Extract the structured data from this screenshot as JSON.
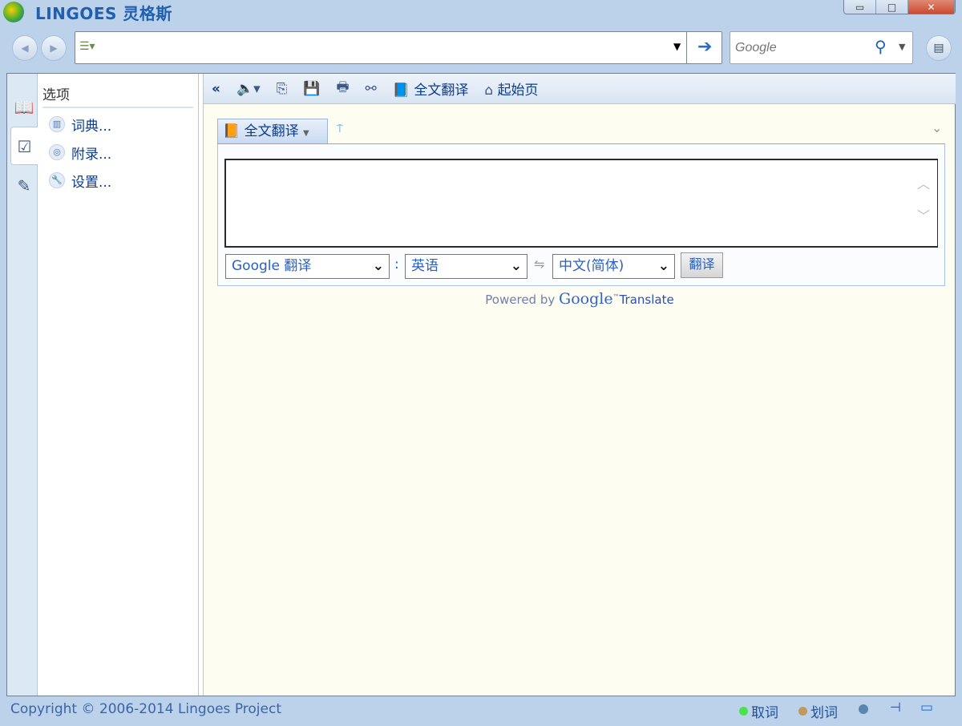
{
  "app": {
    "title": "LINGOES 灵格斯"
  },
  "window": {
    "minimize": "▭",
    "maximize": "□",
    "close": "✕"
  },
  "nav": {
    "address_value": "",
    "search_placeholder": "Google"
  },
  "sidebar": {
    "title": "选项",
    "items": [
      {
        "label": "词典...",
        "icon": "dictionary-icon"
      },
      {
        "label": "附录...",
        "icon": "appendix-icon"
      },
      {
        "label": "设置...",
        "icon": "wrench-icon"
      }
    ]
  },
  "toolbar": {
    "collapse": "«",
    "full_translate": "全文翻译",
    "home": "起始页"
  },
  "translate": {
    "tab_label": "全文翻译",
    "input_value": "",
    "engine": "Google 翻译",
    "colon": ":",
    "source_lang": "英语",
    "target_lang": "中文(简体)",
    "button": "翻译",
    "powered_prefix": "Powered by",
    "powered_brand": "Google",
    "powered_tm": "™",
    "powered_suffix": "Translate"
  },
  "status": {
    "copyright": "Copyright © 2006-2014 Lingoes Project",
    "capture": "取词",
    "select": "划词"
  },
  "colors": {
    "accent": "#0b3c8c",
    "background": "#bcd2ea",
    "content_bg": "#fdfdf1"
  }
}
